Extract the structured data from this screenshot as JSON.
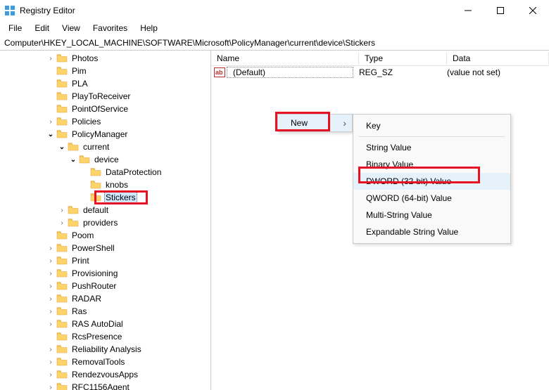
{
  "app": {
    "title": "Registry Editor"
  },
  "menu": {
    "file": "File",
    "edit": "Edit",
    "view": "View",
    "favorites": "Favorites",
    "help": "Help"
  },
  "address": "Computer\\HKEY_LOCAL_MACHINE\\SOFTWARE\\Microsoft\\PolicyManager\\current\\device\\Stickers",
  "tree": {
    "items": [
      {
        "indent": 4,
        "chev": ">",
        "label": "Photos"
      },
      {
        "indent": 4,
        "chev": "",
        "label": "Pim"
      },
      {
        "indent": 4,
        "chev": "",
        "label": "PLA"
      },
      {
        "indent": 4,
        "chev": "",
        "label": "PlayToReceiver"
      },
      {
        "indent": 4,
        "chev": "",
        "label": "PointOfService"
      },
      {
        "indent": 4,
        "chev": ">",
        "label": "Policies"
      },
      {
        "indent": 4,
        "chev": "v",
        "label": "PolicyManager"
      },
      {
        "indent": 5,
        "chev": "v",
        "label": "current"
      },
      {
        "indent": 6,
        "chev": "v",
        "label": "device"
      },
      {
        "indent": 7,
        "chev": "",
        "label": "DataProtection"
      },
      {
        "indent": 7,
        "chev": "",
        "label": "knobs"
      },
      {
        "indent": 7,
        "chev": "",
        "label": "Stickers",
        "selected": true
      },
      {
        "indent": 5,
        "chev": ">",
        "label": "default"
      },
      {
        "indent": 5,
        "chev": ">",
        "label": "providers"
      },
      {
        "indent": 4,
        "chev": "",
        "label": "Poom"
      },
      {
        "indent": 4,
        "chev": ">",
        "label": "PowerShell"
      },
      {
        "indent": 4,
        "chev": ">",
        "label": "Print"
      },
      {
        "indent": 4,
        "chev": ">",
        "label": "Provisioning"
      },
      {
        "indent": 4,
        "chev": ">",
        "label": "PushRouter"
      },
      {
        "indent": 4,
        "chev": ">",
        "label": "RADAR"
      },
      {
        "indent": 4,
        "chev": ">",
        "label": "Ras"
      },
      {
        "indent": 4,
        "chev": ">",
        "label": "RAS AutoDial"
      },
      {
        "indent": 4,
        "chev": "",
        "label": "RcsPresence"
      },
      {
        "indent": 4,
        "chev": ">",
        "label": "Reliability Analysis"
      },
      {
        "indent": 4,
        "chev": ">",
        "label": "RemovalTools"
      },
      {
        "indent": 4,
        "chev": ">",
        "label": "RendezvousApps"
      },
      {
        "indent": 4,
        "chev": ">",
        "label": "RFC1156Agent"
      }
    ]
  },
  "list": {
    "headers": {
      "name": "Name",
      "type": "Type",
      "data": "Data"
    },
    "rows": [
      {
        "name": "(Default)",
        "type": "REG_SZ",
        "data": "(value not set)"
      }
    ]
  },
  "context": {
    "new": "New",
    "sub": [
      "Key",
      "---",
      "String Value",
      "Binary Value",
      "DWORD (32-bit) Value",
      "QWORD (64-bit) Value",
      "Multi-String Value",
      "Expandable String Value"
    ]
  }
}
